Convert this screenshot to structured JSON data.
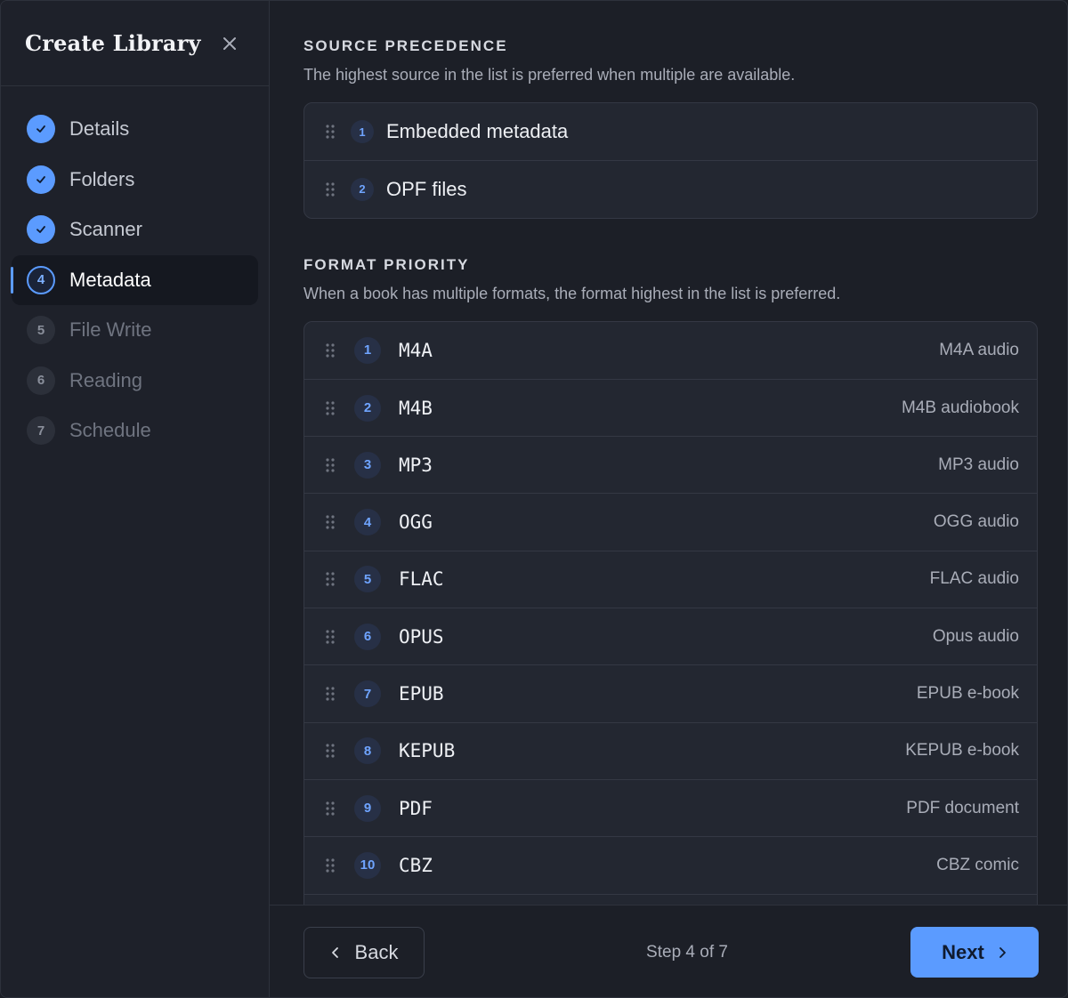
{
  "sidebar": {
    "title": "Create Library",
    "steps": [
      {
        "label": "Details",
        "marker": "",
        "state": "done"
      },
      {
        "label": "Folders",
        "marker": "",
        "state": "done"
      },
      {
        "label": "Scanner",
        "marker": "",
        "state": "done"
      },
      {
        "label": "Metadata",
        "marker": "4",
        "state": "current"
      },
      {
        "label": "File Write",
        "marker": "5",
        "state": "todo"
      },
      {
        "label": "Reading",
        "marker": "6",
        "state": "todo"
      },
      {
        "label": "Schedule",
        "marker": "7",
        "state": "todo"
      }
    ]
  },
  "source_precedence": {
    "title": "SOURCE PRECEDENCE",
    "description": "The highest source in the list is preferred when multiple are available.",
    "items": [
      {
        "rank": "1",
        "label": "Embedded metadata"
      },
      {
        "rank": "2",
        "label": "OPF files"
      }
    ]
  },
  "format_priority": {
    "title": "FORMAT PRIORITY",
    "description": "When a book has multiple formats, the format highest in the list is preferred.",
    "items": [
      {
        "rank": "1",
        "format": "M4A",
        "desc": "M4A audio"
      },
      {
        "rank": "2",
        "format": "M4B",
        "desc": "M4B audiobook"
      },
      {
        "rank": "3",
        "format": "MP3",
        "desc": "MP3 audio"
      },
      {
        "rank": "4",
        "format": "OGG",
        "desc": "OGG audio"
      },
      {
        "rank": "5",
        "format": "FLAC",
        "desc": "FLAC audio"
      },
      {
        "rank": "6",
        "format": "OPUS",
        "desc": "Opus audio"
      },
      {
        "rank": "7",
        "format": "EPUB",
        "desc": "EPUB e-book"
      },
      {
        "rank": "8",
        "format": "KEPUB",
        "desc": "KEPUB e-book"
      },
      {
        "rank": "9",
        "format": "PDF",
        "desc": "PDF document"
      },
      {
        "rank": "10",
        "format": "CBZ",
        "desc": "CBZ comic"
      }
    ]
  },
  "footer": {
    "back_label": "Back",
    "step_indicator": "Step 4 of 7",
    "next_label": "Next"
  },
  "colors": {
    "accent": "#5b9bff",
    "background": "#1c1f27",
    "card": "#232731"
  }
}
